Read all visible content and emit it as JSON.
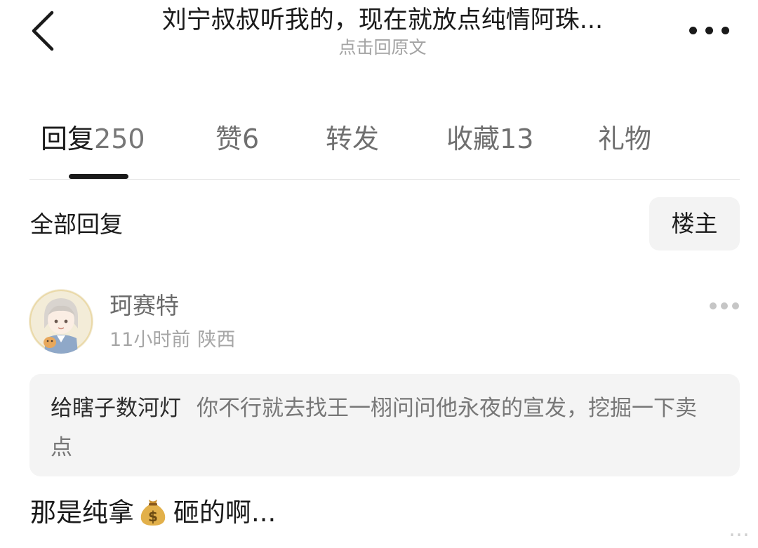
{
  "header": {
    "title": "刘宁叔叔听我的，现在就放点纯情阿珠...",
    "subtitle": "点击回原文",
    "back_icon": "chevron-left-icon",
    "more_icon": "more-horizontal-icon"
  },
  "tabs": [
    {
      "label": "回复",
      "count": "250",
      "active": true
    },
    {
      "label": "赞",
      "count": "6",
      "active": false
    },
    {
      "label": "转发",
      "count": "",
      "active": false
    },
    {
      "label": "收藏",
      "count": "13",
      "active": false
    },
    {
      "label": "礼物",
      "count": "",
      "active": false
    }
  ],
  "filter": {
    "all_label": "全部回复",
    "owner_label": "楼主"
  },
  "comment": {
    "username": "珂赛特",
    "time": "11小时前",
    "location": "陕西",
    "more_icon": "more-horizontal-icon",
    "quote_author": "给瞎子数河灯",
    "quote_text": "你不行就去找王一栩问问他永夜的宣发，挖掘一下卖点",
    "reply_before_emoji": "那是纯拿",
    "emoji": "money-bag-icon",
    "reply_after_emoji": "砸的啊..."
  },
  "watermark": "…"
}
